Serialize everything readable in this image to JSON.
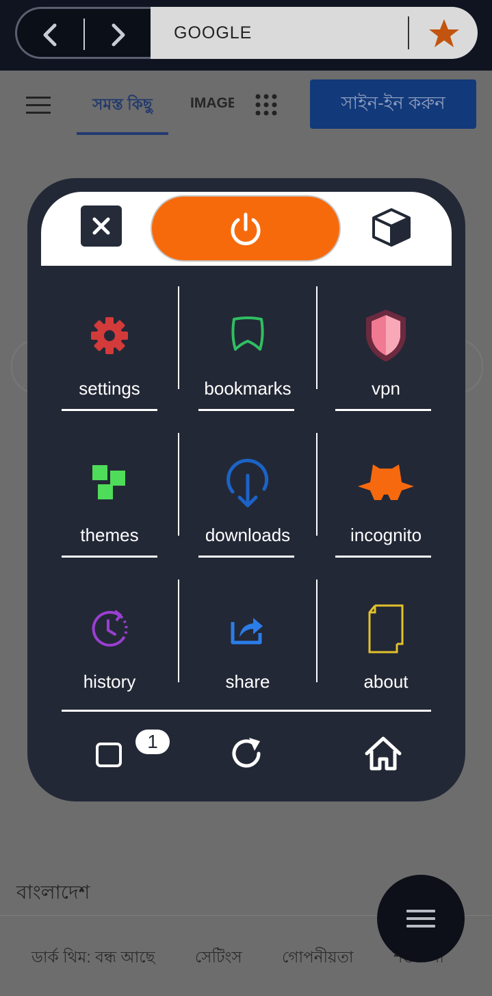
{
  "address_bar": {
    "url_text": "GOOGLE",
    "back_icon": "chevron-left-icon",
    "forward_icon": "chevron-right-icon",
    "bookmark_icon": "star-icon",
    "star_color": "#c2540f"
  },
  "page": {
    "tabs": [
      {
        "label": "সমস্ত কিছু",
        "active": true
      },
      {
        "label": "IMAGES"
      }
    ],
    "signin_label": "সাইন-ইন করুন",
    "country": "বাংলাদেশ",
    "footer_links": [
      "ডার্ক থিম: বন্ধ আছে",
      "সেটিংস",
      "গোপনীয়তা",
      "শর্তাবলী"
    ]
  },
  "menu": {
    "head": {
      "close_icon": "close-icon",
      "power_icon": "power-icon",
      "power_color": "#f76a0c",
      "cube_icon": "cube-icon"
    },
    "items": [
      {
        "label": "settings",
        "icon": "gear-icon",
        "color": "#d33a3a"
      },
      {
        "label": "bookmarks",
        "icon": "bookmark-icon",
        "color": "#2fbf62"
      },
      {
        "label": "vpn",
        "icon": "shield-icon",
        "color": "#ef6f8c"
      },
      {
        "label": "themes",
        "icon": "themes-icon",
        "color": "#4fdc5a"
      },
      {
        "label": "downloads",
        "icon": "download-icon",
        "color": "#1b63c6"
      },
      {
        "label": "incognito",
        "icon": "incognito-icon",
        "color": "#f7690e"
      },
      {
        "label": "history",
        "icon": "history-icon",
        "color": "#9a3fd1"
      },
      {
        "label": "share",
        "icon": "share-icon",
        "color": "#2b7de9"
      },
      {
        "label": "about",
        "icon": "document-icon",
        "color": "#e3c22b"
      }
    ],
    "bottom": {
      "tabs_count": "1",
      "tabs_icon": "tabs-icon",
      "reload_icon": "reload-icon",
      "home_icon": "home-icon"
    }
  },
  "fab_icon": "menu-icon"
}
